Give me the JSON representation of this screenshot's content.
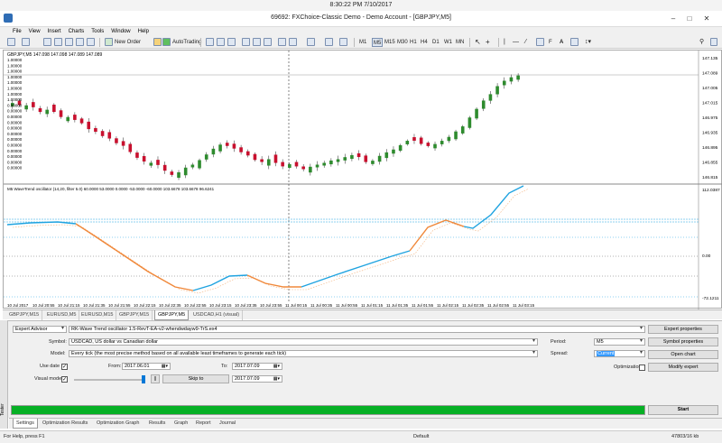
{
  "clock": "8:30:22 PM 7/10/2017",
  "window": {
    "title": "69692: FXChoice-Classic Demo - Demo Account - [GBPJPY,M5]"
  },
  "menu": [
    "File",
    "View",
    "Insert",
    "Charts",
    "Tools",
    "Window",
    "Help"
  ],
  "toolbar": {
    "new_order": "New Order",
    "autotrading": "AutoTrading",
    "timeframes": [
      "M1",
      "M5",
      "M15",
      "M30",
      "H1",
      "H4",
      "D1",
      "W1",
      "MN"
    ]
  },
  "chart": {
    "header": "GBPJPY,M5  147.098 147.098 147.089 147.089",
    "left_labels": [
      "1.00000",
      "1.00000",
      "1.00000",
      "1.00000",
      "1.00000",
      "1.00000",
      "1.00000",
      "1.00000",
      "0.00000",
      "0.00000",
      "0.00000",
      "0.00000",
      "0.00000",
      "0.00000",
      "0.00000",
      "0.00000",
      "0.00000",
      "0.00000",
      "0.00000",
      "0.00000"
    ],
    "price_ticks": [
      "147.135",
      "147.089",
      "147.005",
      "147.015",
      "146.975",
      "146.935",
      "146.895",
      "146.855",
      "146.815"
    ],
    "indicator_header": "M5 WaveTrend oscillator (14,20, filter 5.0) 60.0000 53.0000 0.0000 -53.0000 -60.0000 103.6678 103.6678 96.6241",
    "indicator_ticks": [
      "112.0387",
      "0.00",
      "-72.1211"
    ],
    "time_labels": [
      "10 Jul 2017",
      "10 Jul 20:55",
      "10 Jul 21:15",
      "10 Jul 21:35",
      "10 Jul 21:55",
      "10 Jul 22:15",
      "10 Jul 22:35",
      "10 Jul 22:55",
      "10 Jul 23:15",
      "10 Jul 23:35",
      "10 Jul 23:55",
      "11 Jul 00:15",
      "11 Jul 00:35",
      "11 Jul 00:55",
      "11 Jul 01:15",
      "11 Jul 01:35",
      "11 Jul 01:55",
      "11 Jul 02:15",
      "11 Jul 02:35",
      "11 Jul 02:55",
      "11 Jul 03:15"
    ],
    "colors": {
      "bull": "#2e8b2e",
      "bear": "#c8102e",
      "wt_up": "#1fa3e0",
      "wt_down": "#f0883a",
      "signal": "#f3b07a",
      "levels": "#1fa3e0"
    }
  },
  "window_tabs": [
    "GBPJPY,M15",
    "EURUSD,M5",
    "EURUSD,M15",
    "GBPJPY,M15",
    "GBPJPY,M5",
    "USDCAD,H1 (visual)"
  ],
  "tester": {
    "type": "Expert Advisor",
    "expert": "RK-Wave Trend oscillator 1.5-RevT-EA-v2-whendwdayw9-TrS.ex4",
    "symbol_label": "Symbol:",
    "symbol": "USDCAD, US dollar  vs Canadian dollar",
    "model_label": "Model:",
    "model": "Every tick (the most precise method based on all available least timeframes to generate each tick)",
    "use_date_label": "Use date",
    "from_label": "From:",
    "from": "2017.06.01",
    "to_label": "To:",
    "to": "2017.07.09",
    "visual_label": "Visual mode",
    "skip_label": "Skip to",
    "skip_date": "2017.07.09",
    "period_label": "Period:",
    "period": "M5",
    "spread_label": "Spread:",
    "spread": "Current",
    "optimization_label": "Optimization",
    "buttons": {
      "expert_properties": "Expert properties",
      "symbol_properties": "Symbol properties",
      "open_chart": "Open chart",
      "modify_expert": "Modify expert",
      "start": "Start"
    },
    "side_label": "Tester"
  },
  "bottom_tabs": [
    "Settings",
    "Optimization Results",
    "Optimization Graph",
    "Results",
    "Graph",
    "Report",
    "Journal"
  ],
  "status": {
    "help": "For Help, press F1",
    "profile": "Default",
    "traffic": "47803/16 kb"
  }
}
